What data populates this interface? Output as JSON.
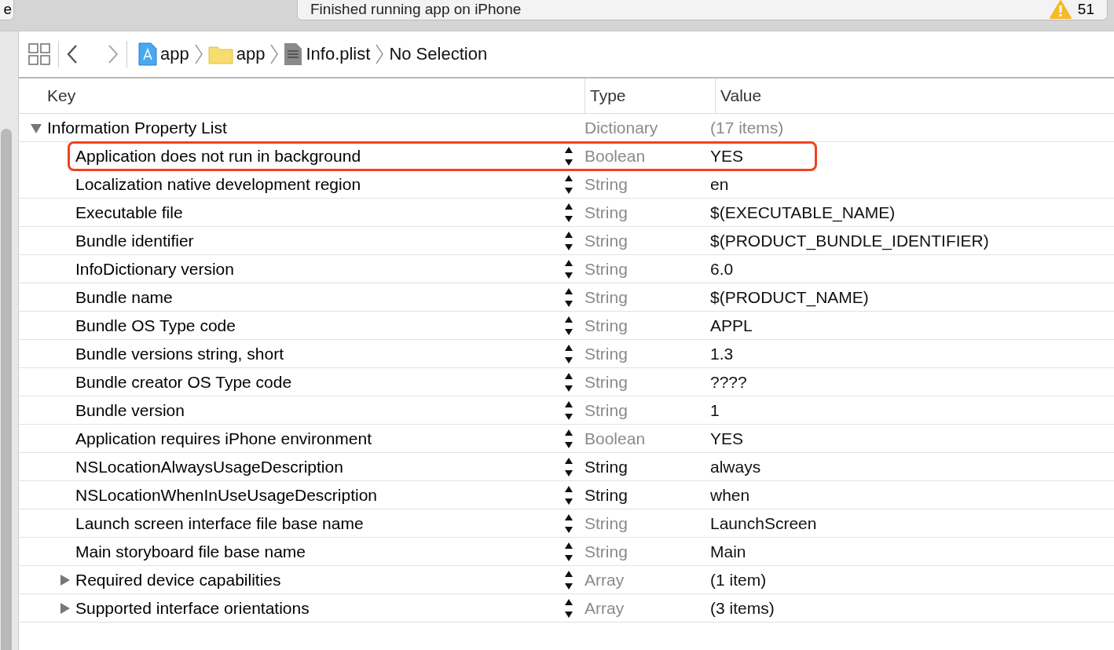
{
  "toolbar": {
    "left_tab_label": "e",
    "status": "Finished running app on iPhone",
    "warning_count": "51"
  },
  "jump_bar": {
    "path": [
      {
        "kind": "project",
        "label": "app"
      },
      {
        "kind": "folder",
        "label": "app"
      },
      {
        "kind": "plist",
        "label": "Info.plist"
      }
    ],
    "selection": "No Selection"
  },
  "table": {
    "columns": [
      "Key",
      "Type",
      "Value"
    ],
    "rows": [
      {
        "key": "Information Property List",
        "type": "Dictionary",
        "value": "(17 items)",
        "expanded": true,
        "type_dimmed": true,
        "highlighted": false,
        "children": [
          {
            "key": "Application does not run in background",
            "type": "Boolean",
            "value": "YES",
            "type_dimmed": true,
            "highlighted": true
          },
          {
            "key": "Localization native development region",
            "type": "String",
            "value": "en",
            "type_dimmed": true,
            "highlighted": false
          },
          {
            "key": "Executable file",
            "type": "String",
            "value": "$(EXECUTABLE_NAME)",
            "type_dimmed": true,
            "highlighted": false
          },
          {
            "key": "Bundle identifier",
            "type": "String",
            "value": "$(PRODUCT_BUNDLE_IDENTIFIER)",
            "type_dimmed": true,
            "highlighted": false
          },
          {
            "key": "InfoDictionary version",
            "type": "String",
            "value": "6.0",
            "type_dimmed": true,
            "highlighted": false
          },
          {
            "key": "Bundle name",
            "type": "String",
            "value": "$(PRODUCT_NAME)",
            "type_dimmed": true,
            "highlighted": false
          },
          {
            "key": "Bundle OS Type code",
            "type": "String",
            "value": "APPL",
            "type_dimmed": true,
            "highlighted": false
          },
          {
            "key": "Bundle versions string, short",
            "type": "String",
            "value": "1.3",
            "type_dimmed": true,
            "highlighted": false
          },
          {
            "key": "Bundle creator OS Type code",
            "type": "String",
            "value": "????",
            "type_dimmed": true,
            "highlighted": false
          },
          {
            "key": "Bundle version",
            "type": "String",
            "value": "1",
            "type_dimmed": true,
            "highlighted": false
          },
          {
            "key": "Application requires iPhone environment",
            "type": "Boolean",
            "value": "YES",
            "type_dimmed": true,
            "highlighted": false
          },
          {
            "key": "NSLocationAlwaysUsageDescription",
            "type": "String",
            "value": "always",
            "type_dimmed": false,
            "highlighted": false
          },
          {
            "key": "NSLocationWhenInUseUsageDescription",
            "type": "String",
            "value": "when",
            "type_dimmed": false,
            "highlighted": false
          },
          {
            "key": "Launch screen interface file base name",
            "type": "String",
            "value": "LaunchScreen",
            "type_dimmed": true,
            "highlighted": false
          },
          {
            "key": "Main storyboard file base name",
            "type": "String",
            "value": "Main",
            "type_dimmed": true,
            "highlighted": false
          },
          {
            "key": "Required device capabilities",
            "type": "Array",
            "value": "(1 item)",
            "expanded": false,
            "type_dimmed": true,
            "highlighted": false
          },
          {
            "key": "Supported interface orientations",
            "type": "Array",
            "value": "(3 items)",
            "expanded": false,
            "type_dimmed": true,
            "highlighted": false
          }
        ]
      }
    ]
  }
}
